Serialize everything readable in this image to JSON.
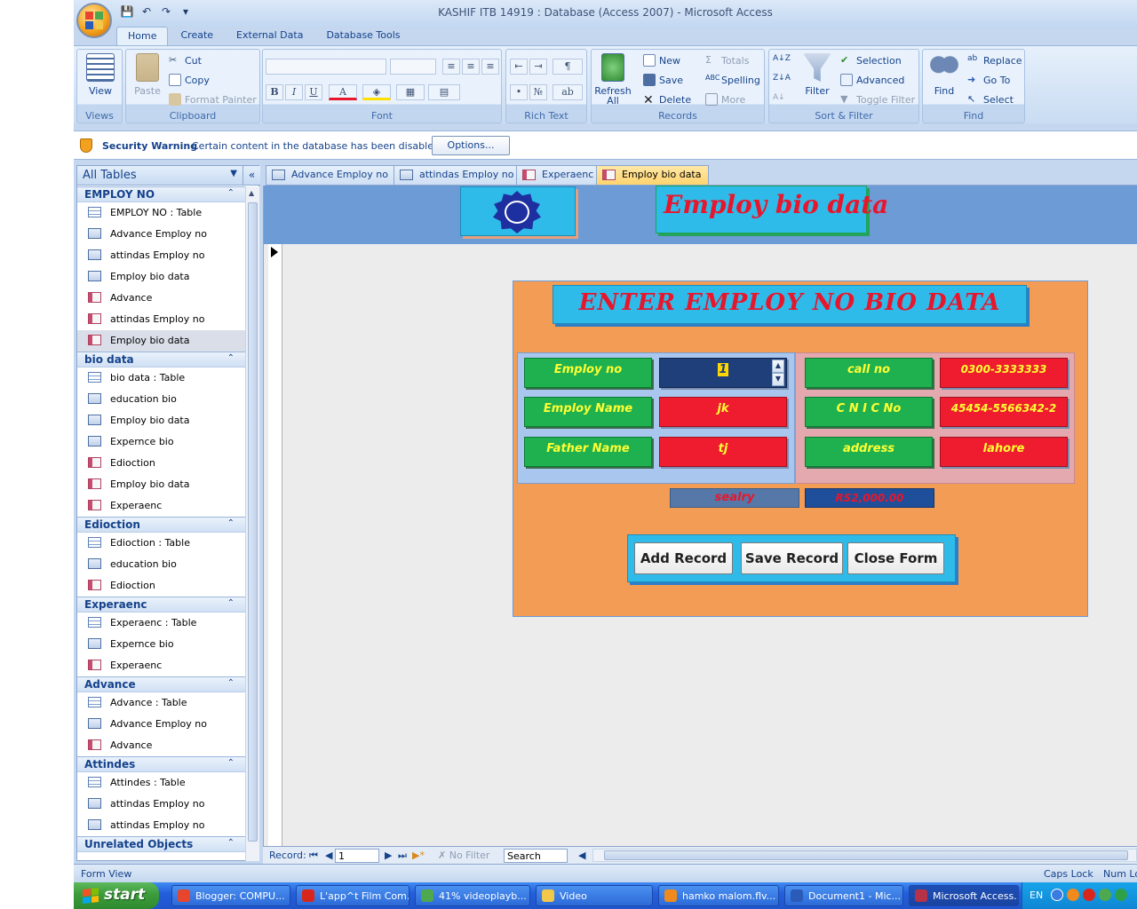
{
  "window": {
    "title": "KASHIF ITB 14919 : Database (Access 2007) - Microsoft Access"
  },
  "ribbon_tabs": [
    "Home",
    "Create",
    "External Data",
    "Database Tools"
  ],
  "ribbon": {
    "views": {
      "label": "Views",
      "view": "View"
    },
    "clipboard": {
      "label": "Clipboard",
      "paste": "Paste",
      "cut": "Cut",
      "copy": "Copy",
      "format_painter": "Format Painter"
    },
    "font": {
      "label": "Font",
      "bold": "B",
      "italic": "I",
      "underline": "U",
      "color": "A"
    },
    "rich_text": {
      "label": "Rich Text"
    },
    "records": {
      "label": "Records",
      "refresh": "Refresh",
      "refresh_all": "All",
      "new": "New",
      "save": "Save",
      "delete": "Delete",
      "totals": "Totals",
      "spelling": "Spelling",
      "more": "More"
    },
    "sort_filter": {
      "label": "Sort & Filter",
      "filter": "Filter",
      "selection": "Selection",
      "advanced": "Advanced",
      "toggle_filter": "Toggle Filter"
    },
    "find": {
      "label": "Find",
      "find": "Find",
      "replace": "Replace",
      "goto": "Go To",
      "select": "Select"
    }
  },
  "security": {
    "title": "Security Warning",
    "message": "Certain content in the database has been disabled",
    "options": "Options..."
  },
  "nav": {
    "header": "All Tables",
    "collapse": "«",
    "groups": [
      {
        "name": "EMPLOY NO",
        "items": [
          {
            "label": "EMPLOY NO : Table",
            "type": "tbl"
          },
          {
            "label": "Advance  Employ no",
            "type": "qry"
          },
          {
            "label": "attindas Employ no",
            "type": "qry"
          },
          {
            "label": "Employ  bio data",
            "type": "qry"
          },
          {
            "label": "Advance",
            "type": "frm"
          },
          {
            "label": "attindas Employ no",
            "type": "frm"
          },
          {
            "label": "Employ  bio data",
            "type": "frm",
            "selected": true
          }
        ]
      },
      {
        "name": "bio data",
        "items": [
          {
            "label": "bio data : Table",
            "type": "tbl"
          },
          {
            "label": "education bio",
            "type": "qry"
          },
          {
            "label": "Employ  bio data",
            "type": "qry"
          },
          {
            "label": "Expernce bio",
            "type": "qry"
          },
          {
            "label": "Edioction",
            "type": "frm"
          },
          {
            "label": "Employ  bio data",
            "type": "frm"
          },
          {
            "label": "Experaenc",
            "type": "frm"
          }
        ]
      },
      {
        "name": "Edioction",
        "items": [
          {
            "label": "Edioction : Table",
            "type": "tbl"
          },
          {
            "label": "education bio",
            "type": "qry"
          },
          {
            "label": "Edioction",
            "type": "frm"
          }
        ]
      },
      {
        "name": "Experaenc",
        "items": [
          {
            "label": "Experaenc : Table",
            "type": "tbl"
          },
          {
            "label": "Expernce bio",
            "type": "qry"
          },
          {
            "label": "Experaenc",
            "type": "frm"
          }
        ]
      },
      {
        "name": "Advance",
        "items": [
          {
            "label": "Advance : Table",
            "type": "tbl"
          },
          {
            "label": "Advance  Employ no",
            "type": "qry"
          },
          {
            "label": "Advance",
            "type": "frm"
          }
        ]
      },
      {
        "name": "Attindes",
        "items": [
          {
            "label": "Attindes : Table",
            "type": "tbl"
          },
          {
            "label": "attindas Employ no",
            "type": "qry"
          },
          {
            "label": "attindas Employ no",
            "type": "qry"
          }
        ]
      },
      {
        "name": "Unrelated Objects",
        "items": []
      }
    ]
  },
  "doc_tabs": [
    {
      "label": "Advance  Employ no",
      "type": "qry"
    },
    {
      "label": "attindas Employ no",
      "type": "qry"
    },
    {
      "label": "Experaenc",
      "type": "frm"
    },
    {
      "label": "Employ  bio data",
      "type": "frm",
      "active": true
    }
  ],
  "form": {
    "header_title": "Employ  bio data",
    "banner": "ENTER  EMPLOY NO BIO DATA",
    "labels": {
      "employ_no": "Employ no",
      "employ_name": "Employ Name",
      "father_name": "Father Name",
      "call_no": "call no",
      "cnic": "C N I C No",
      "address": "address",
      "salary": "sealry"
    },
    "values": {
      "employ_no": "1",
      "employ_name": "jk",
      "father_name": "tj",
      "call_no": "0300-3333333",
      "cnic": "45454-5566342-2",
      "address": "lahore",
      "salary": "RS2,000.00"
    },
    "buttons": {
      "add": "Add Record",
      "save": "Save Record",
      "close": "Close Form"
    }
  },
  "record_nav": {
    "label": "Record:",
    "current": "1",
    "no_filter": "No Filter",
    "search": "Search"
  },
  "status": {
    "view": "Form View",
    "caps": "Caps Lock",
    "num": "Num Lo"
  },
  "taskbar": {
    "start": "start",
    "tasks": [
      {
        "label": "Blogger: COMPU...",
        "color": "#e8452f"
      },
      {
        "label": "L'app^t Film Com...",
        "color": "#d9261c"
      },
      {
        "label": "41% videoplayb...",
        "color": "#4ea84e"
      },
      {
        "label": "Video",
        "color": "#f3c84a"
      },
      {
        "label": "hamko malom.flv...",
        "color": "#f08a1c"
      },
      {
        "label": "Document1 - Mic...",
        "color": "#2a5bb8"
      },
      {
        "label": "Microsoft Access...",
        "color": "#b83247",
        "active": true
      }
    ],
    "lang": "EN"
  },
  "colors": {
    "accent": "#15428b",
    "header_band": "#6d9bd6",
    "panel": "#f39c55",
    "label_green": "#1fb14f",
    "value_red": "#ee1c2e",
    "cyan": "#2fbbe9"
  }
}
